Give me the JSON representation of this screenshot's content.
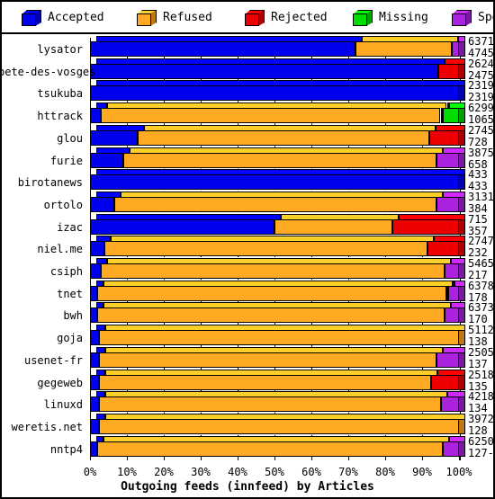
{
  "legend": {
    "items": [
      {
        "label": "Accepted",
        "color": "#0000ee",
        "icon": "cube-icon"
      },
      {
        "label": "Refused",
        "color": "#ffaa22",
        "icon": "cube-icon"
      },
      {
        "label": "Rejected",
        "color": "#ee0000",
        "icon": "cube-icon"
      },
      {
        "label": "Missing",
        "color": "#00dd00",
        "icon": "cube-icon"
      },
      {
        "label": "Spooled",
        "color": "#aa22dd",
        "icon": "cube-icon"
      }
    ]
  },
  "chart_data": {
    "type": "bar",
    "orientation": "horizontal",
    "stacked": true,
    "normalized": "100%",
    "title": "Outgoing feeds (innfeed) by Articles",
    "xlabel": "",
    "ylabel": "",
    "xlim": [
      0,
      100
    ],
    "xtick_labels": [
      "0%",
      "10%",
      "20%",
      "30%",
      "40%",
      "50%",
      "60%",
      "70%",
      "80%",
      "90%",
      "100%"
    ],
    "xtick_values": [
      0,
      10,
      20,
      30,
      40,
      50,
      60,
      70,
      80,
      90,
      100
    ],
    "grid": "vertical-dashed",
    "legend_position": "top",
    "series_names": [
      "Accepted",
      "Refused",
      "Rejected",
      "Missing",
      "Spooled"
    ],
    "series_colors": [
      "#0000ee",
      "#ffaa22",
      "#ee0000",
      "#00dd00",
      "#aa22dd"
    ],
    "categories": [
      "lysator",
      "bete-des-vosges",
      "tsukuba",
      "httrack",
      "glou",
      "furie",
      "birotanews",
      "ortolo",
      "izac",
      "niel.me",
      "csiph",
      "tnet",
      "bwh",
      "goja",
      "usenet-fr",
      "gegeweb",
      "linuxd",
      "weretis.net",
      "nntp4"
    ],
    "rows": [
      {
        "name": "lysator",
        "value_top": "6371",
        "value_bottom": "4745",
        "pct": [
          72.0,
          26.0,
          0.0,
          0.0,
          2.0
        ]
      },
      {
        "name": "bete-des-vosges",
        "value_top": "2624",
        "value_bottom": "2475",
        "pct": [
          94.3,
          0.0,
          5.7,
          0.0,
          0.0
        ]
      },
      {
        "name": "tsukuba",
        "value_top": "2319",
        "value_bottom": "2319",
        "pct": [
          100.0,
          0.0,
          0.0,
          0.0,
          0.0
        ]
      },
      {
        "name": "httrack",
        "value_top": "6299",
        "value_bottom": "1065",
        "pct": [
          3.0,
          92.0,
          0.5,
          4.5,
          0.0
        ]
      },
      {
        "name": "glou",
        "value_top": "2745",
        "value_bottom": "728",
        "pct": [
          13.0,
          79.0,
          8.0,
          0.0,
          0.0
        ]
      },
      {
        "name": "furie",
        "value_top": "3875",
        "value_bottom": "658",
        "pct": [
          9.0,
          85.0,
          0.0,
          0.0,
          6.0
        ]
      },
      {
        "name": "birotanews",
        "value_top": "433",
        "value_bottom": "433",
        "pct": [
          100.0,
          0.0,
          0.0,
          0.0,
          0.0
        ]
      },
      {
        "name": "ortolo",
        "value_top": "3131",
        "value_bottom": "384",
        "pct": [
          6.5,
          87.5,
          0.0,
          0.0,
          6.0
        ]
      },
      {
        "name": "izac",
        "value_top": "715",
        "value_bottom": "357",
        "pct": [
          50.0,
          32.0,
          18.0,
          0.0,
          0.0
        ]
      },
      {
        "name": "niel.me",
        "value_top": "2747",
        "value_bottom": "232",
        "pct": [
          4.0,
          87.5,
          8.5,
          0.0,
          0.0
        ]
      },
      {
        "name": "csiph",
        "value_top": "5465",
        "value_bottom": "217",
        "pct": [
          3.0,
          93.0,
          0.0,
          0.0,
          4.0
        ]
      },
      {
        "name": "tnet",
        "value_top": "6378",
        "value_bottom": "178",
        "pct": [
          2.0,
          94.5,
          0.5,
          0.0,
          3.0
        ]
      },
      {
        "name": "bwh",
        "value_top": "6373",
        "value_bottom": "170",
        "pct": [
          2.0,
          94.0,
          0.0,
          0.0,
          4.0
        ]
      },
      {
        "name": "goja",
        "value_top": "5112",
        "value_bottom": "138",
        "pct": [
          2.5,
          97.5,
          0.0,
          0.0,
          0.0
        ]
      },
      {
        "name": "usenet-fr",
        "value_top": "2505",
        "value_bottom": "137",
        "pct": [
          2.5,
          91.5,
          0.0,
          0.0,
          6.0
        ]
      },
      {
        "name": "gegeweb",
        "value_top": "2518",
        "value_bottom": "135",
        "pct": [
          2.5,
          90.0,
          7.5,
          0.0,
          0.0
        ]
      },
      {
        "name": "linuxd",
        "value_top": "4218",
        "value_bottom": "134",
        "pct": [
          2.5,
          92.5,
          0.0,
          0.0,
          5.0
        ]
      },
      {
        "name": "weretis.net",
        "value_top": "3972",
        "value_bottom": "128",
        "pct": [
          2.5,
          97.5,
          0.0,
          0.0,
          0.0
        ]
      },
      {
        "name": "nntp4",
        "value_top": "6250",
        "value_bottom": "127-",
        "pct": [
          2.0,
          93.5,
          0.0,
          0.0,
          4.5
        ]
      }
    ]
  }
}
